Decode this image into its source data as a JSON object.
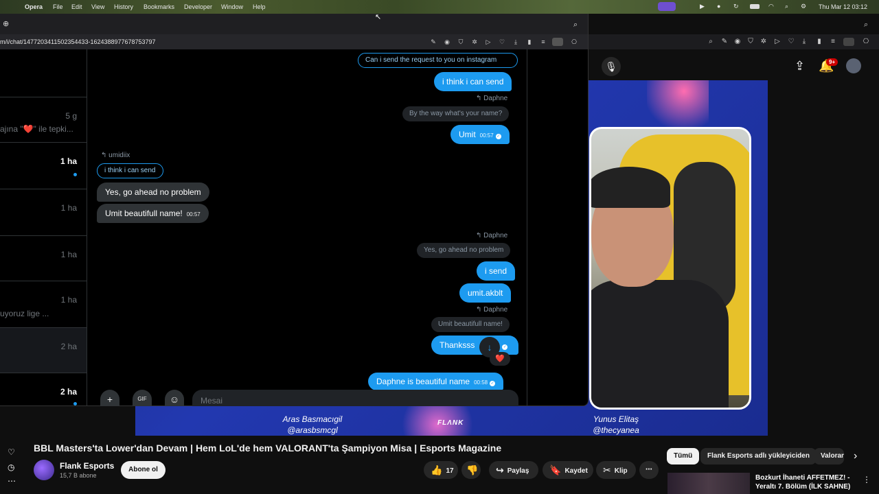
{
  "menubar": {
    "app": "Opera",
    "items": [
      "File",
      "Edit",
      "View",
      "History",
      "Bookmarks",
      "Developer",
      "Window",
      "Help"
    ],
    "clock": "Thu Mar 12  03:12"
  },
  "popup": {
    "url": "m/i/chat/1477203411502354433-1624388977678753797",
    "inbox": [
      {
        "time": "",
        "snippet": ""
      },
      {
        "time": "5 g",
        "snippet": "ajına \"❤️\" ile tepki..."
      },
      {
        "time": "1 ha",
        "snippet": "",
        "unread": true
      },
      {
        "time": "1 ha",
        "snippet": ""
      },
      {
        "time": "1 ha",
        "snippet": ""
      },
      {
        "time": "1 ha",
        "snippet": "uyoruz lige ..."
      },
      {
        "time": "2 ha",
        "snippet": ""
      },
      {
        "time": "2 ha",
        "snippet": "",
        "unread": true
      }
    ],
    "chat": {
      "m1_quote": "Can i send the request to you on instagram",
      "m2": "i think i can send",
      "m3_replyto": "Daphne",
      "m3_quote": "By the way what's your name?",
      "m3": "Umit",
      "m3_time": "00:57",
      "t1_replyto": "umidiix",
      "t1_quote": "i think i can send",
      "t1": "Yes, go ahead no problem",
      "t2": "Umit beautifull name!",
      "t2_time": "00:57",
      "m4_replyto": "Daphne",
      "m4_quote": "Yes, go ahead no problem",
      "m4": "i send",
      "m5": "umit.akblt",
      "m6_replyto": "Daphne",
      "m6_quote": "Umit beautifull name!",
      "m6": "Thanksss",
      "m7": "Daphne is beautiful name",
      "m7_time": "00:58",
      "reaction": "❤️"
    },
    "composer_placeholder": "Mesai"
  },
  "youtube": {
    "title": "BBL Masters'ta Lower'dan Devam | Hem LoL'de hem VALORANT'ta Şampiyon Misa | Esports Magazine",
    "channel": "Flank Esports",
    "subs": "15,7 B abone",
    "subscribe": "Abone ol",
    "likes": "17",
    "share": "Paylaş",
    "save": "Kaydet",
    "clip": "Klip",
    "chips": [
      "Tümü",
      "Flank Esports adlı yükleyiciden",
      "Valorant"
    ],
    "notif_badge": "9+",
    "video_overlay": {
      "left_name": "Aras Basmacıgil",
      "left_handle": "@arasbsmcgl",
      "right_name": "Yunus Elitaş",
      "right_handle": "@thecyanea",
      "brand": "FLΛNK"
    },
    "rec_title": "Bozkurt İhaneti AFFETMEZ! - Yeraltı 7. Bölüm (İLK SAHNE)"
  }
}
